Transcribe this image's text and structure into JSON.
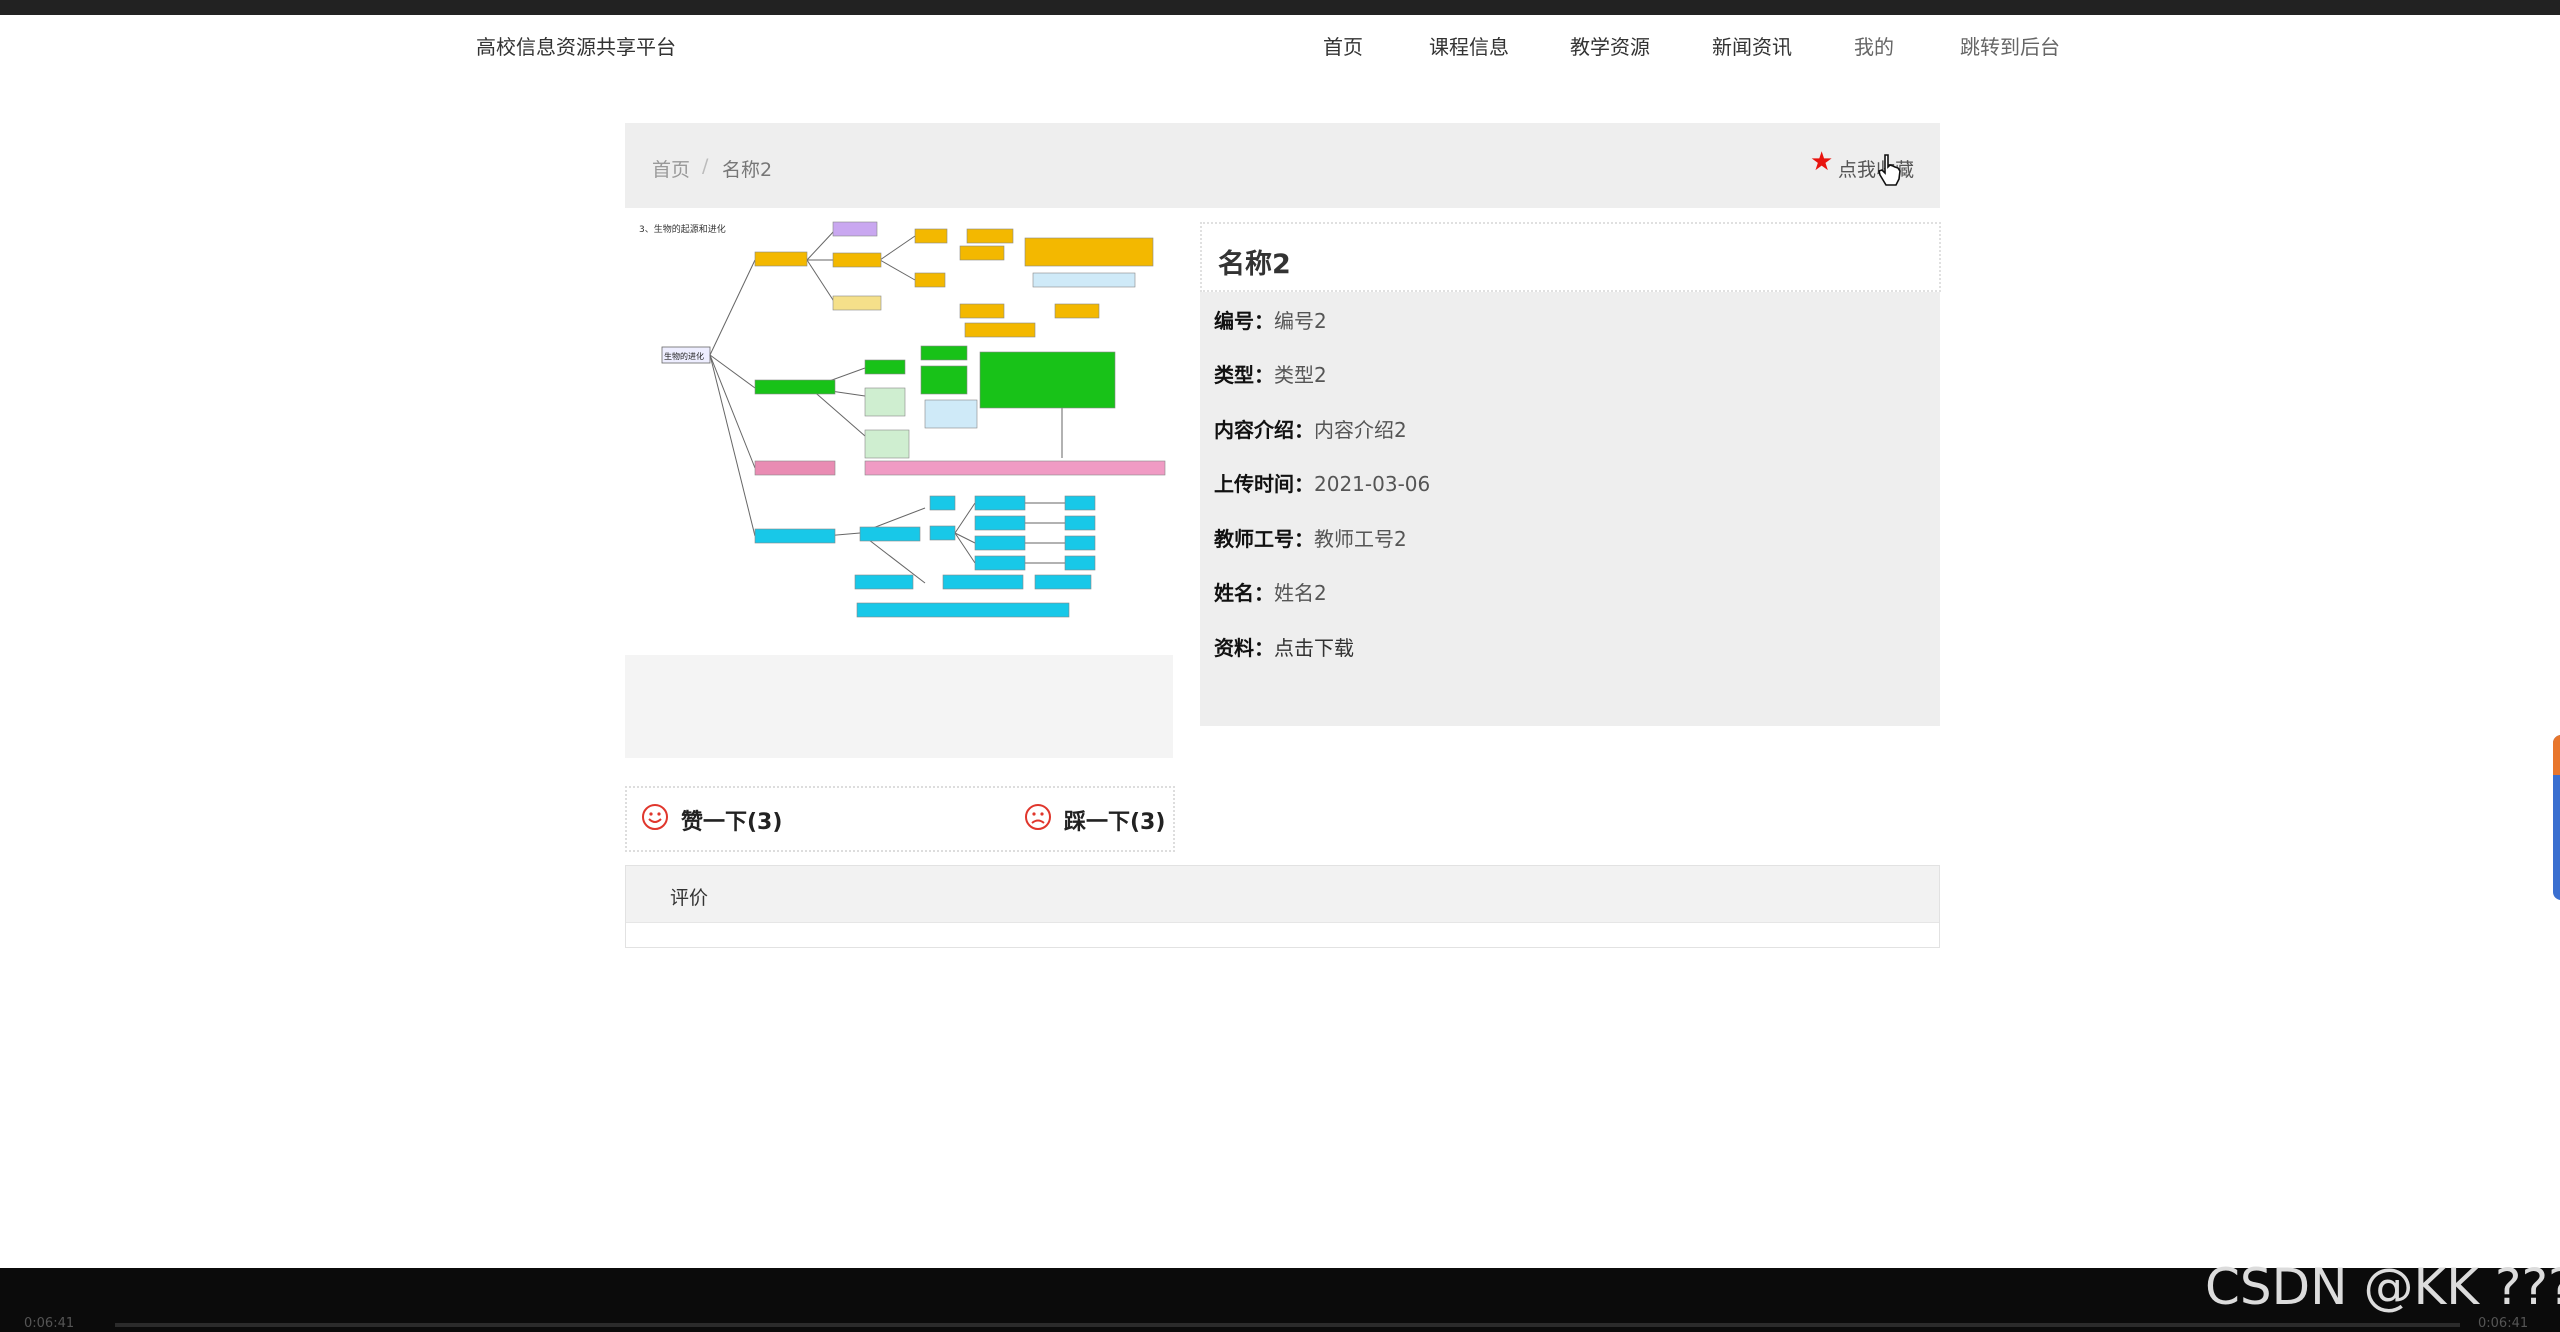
{
  "header": {
    "brand": "高校信息资源共享平台",
    "nav": [
      "首页",
      "课程信息",
      "教学资源",
      "新闻资讯",
      "我的",
      "跳转到后台"
    ]
  },
  "breadcrumb": {
    "home": "首页",
    "separator": "/",
    "current": "名称2"
  },
  "favorite": {
    "label": "点我收藏",
    "star_color": "#e8140f"
  },
  "detail": {
    "title": "名称2",
    "fields": [
      {
        "label": "编号：",
        "value": "编号2"
      },
      {
        "label": "类型：",
        "value": "类型2"
      },
      {
        "label": "内容介绍：",
        "value": "内容介绍2"
      },
      {
        "label": "上传时间：",
        "value": "2021-03-06"
      },
      {
        "label": "教师工号：",
        "value": "教师工号2"
      },
      {
        "label": "姓名：",
        "value": "姓名2"
      },
      {
        "label": "资料：",
        "value": "点击下载"
      }
    ]
  },
  "votes": {
    "like_label": "赞一下(3)",
    "dislike_label": "踩一下(3)"
  },
  "reviews": {
    "title": "评价"
  },
  "watermark": "CSDN @KK ???",
  "player": {
    "time_left": "0:06:41",
    "time_right": "0:06:41"
  },
  "mindmap": {
    "caption": "3、生物的起源和进化",
    "root": "生物的进化"
  }
}
